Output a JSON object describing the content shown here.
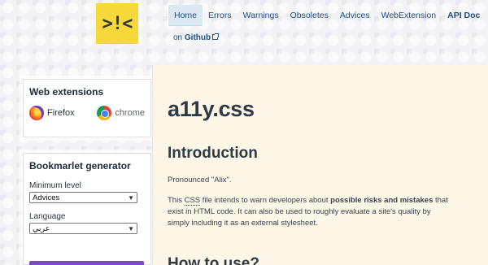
{
  "logo": {
    "text": ">!<"
  },
  "nav": {
    "items": [
      "Home",
      "Errors",
      "Warnings",
      "Obsoletes",
      "Advices",
      "WebExtension",
      "API Doc"
    ],
    "github_prefix": "on ",
    "github_label": "Github"
  },
  "web_extensions": {
    "title": "Web extensions",
    "firefox": "Firefox",
    "chrome": "chrome"
  },
  "bookmarklet": {
    "title": "Bookmarlet generator",
    "level_label": "Minimum level",
    "level_value": "Advices",
    "language_label": "Language",
    "language_value": "عربي"
  },
  "main": {
    "title": "a11y.css",
    "intro_heading": "Introduction",
    "pronounced": "Pronounced \"Alix\".",
    "desc_1": "This ",
    "desc_abbr": "CSS",
    "desc_2": " file intends to warn developers about ",
    "desc_strong": "possible risks and mistakes",
    "desc_3": " that exist in HTML code. It can also be used to roughly evaluate a site's quality by simply in­cluding it as an external stylesheet.",
    "how_heading": "How to use?"
  },
  "colors": {
    "logo_bg": "#f7d83a",
    "nav_link": "#1f4f86",
    "main_bg": "#fbf6e6",
    "bookmarklet_button": "#7a4cbf"
  }
}
